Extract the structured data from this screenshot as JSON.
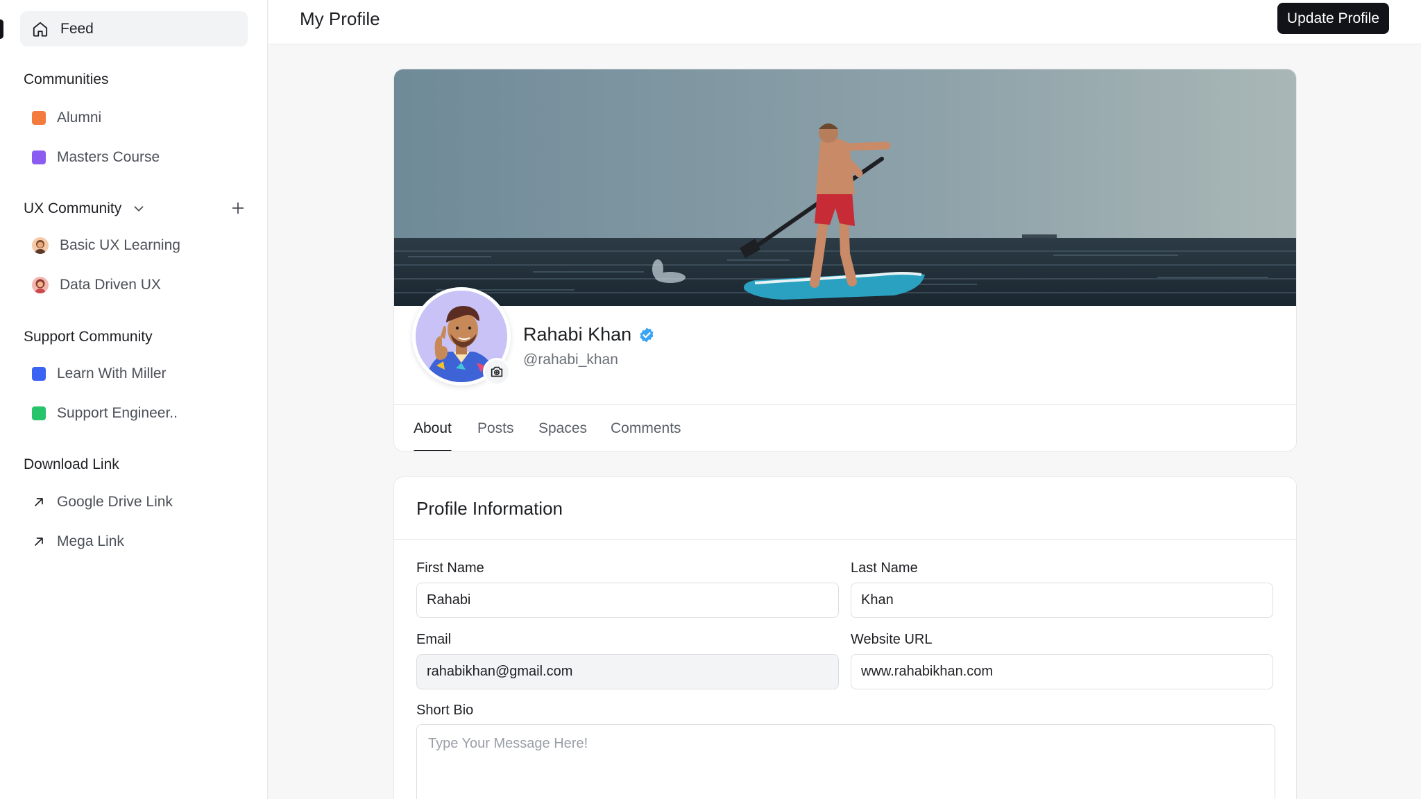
{
  "sidebar": {
    "feed_label": "Feed",
    "sections": [
      {
        "heading": "Communities",
        "items": [
          {
            "label": "Alumni",
            "color": "#f47b3e"
          },
          {
            "label": "Masters Course",
            "color": "#8a5cf0"
          }
        ]
      },
      {
        "heading": "UX Community",
        "items": [
          {
            "label": "Basic UX Learning",
            "icon": "avatar"
          },
          {
            "label": "Data Driven UX",
            "icon": "avatar"
          }
        ]
      },
      {
        "heading": "Support Community",
        "items": [
          {
            "label": "Learn With Miller",
            "color": "#3b63f3"
          },
          {
            "label": "Support Engineer..",
            "color": "#27c46b"
          }
        ]
      },
      {
        "heading": "Download Link",
        "items": [
          {
            "label": "Google Drive Link",
            "icon": "arrow-up-right-icon"
          },
          {
            "label": "Mega Link",
            "icon": "arrow-up-right-icon"
          }
        ]
      }
    ]
  },
  "header": {
    "title": "My Profile",
    "update_button": "Update Profile"
  },
  "profile": {
    "name": "Rahabi Khan",
    "handle": "@rahabi_khan",
    "verified": true,
    "tabs": [
      {
        "label": "About",
        "active": true
      },
      {
        "label": "Posts",
        "active": false
      },
      {
        "label": "Spaces",
        "active": false
      },
      {
        "label": "Comments",
        "active": false
      }
    ]
  },
  "profile_info": {
    "title": "Profile Information",
    "first_name": {
      "label": "First Name",
      "value": "Rahabi"
    },
    "last_name": {
      "label": "Last Name",
      "value": "Khan"
    },
    "email": {
      "label": "Email",
      "value": "rahabikhan@gmail.com"
    },
    "website": {
      "label": "Website URL",
      "value": "www.rahabikhan.com"
    },
    "bio": {
      "label": "Short Bio",
      "placeholder": "Type Your Message Here!"
    }
  },
  "colors": {
    "primary_button": "#111318",
    "verified_badge": "#3aa3f2",
    "avatar_bg": "#c8c2f7"
  }
}
